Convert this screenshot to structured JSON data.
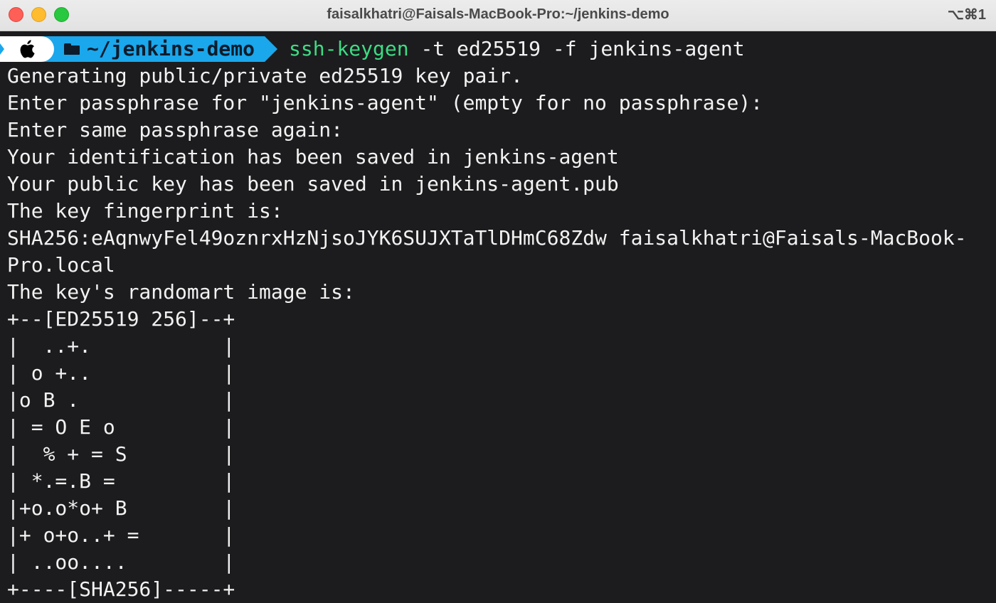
{
  "window": {
    "title": "faisalkhatri@Faisals-MacBook-Pro:~/jenkins-demo",
    "shortcut": "⌥⌘1"
  },
  "prompt": {
    "apple_icon": "",
    "directory": "~/jenkins-demo",
    "command": "ssh-keygen",
    "args": " -t ed25519 -f jenkins-agent"
  },
  "output": [
    "Generating public/private ed25519 key pair.",
    "Enter passphrase for \"jenkins-agent\" (empty for no passphrase):",
    "Enter same passphrase again:",
    "Your identification has been saved in jenkins-agent",
    "Your public key has been saved in jenkins-agent.pub",
    "The key fingerprint is:",
    "SHA256:eAqnwyFel49oznrxHzNjsoJYK6SUJXTaTlDHmC68Zdw faisalkhatri@Faisals-MacBook-",
    "Pro.local",
    "The key's randomart image is:",
    "+--[ED25519 256]--+",
    "|  ..+.           |",
    "| o +..           |",
    "|o B .            |",
    "| = O E o         |",
    "|  % + = S        |",
    "| *.=.B =         |",
    "|+o.o*o+ B        |",
    "|+ o+o..+ =       |",
    "| ..oo....        |",
    "+----[SHA256]-----+"
  ]
}
